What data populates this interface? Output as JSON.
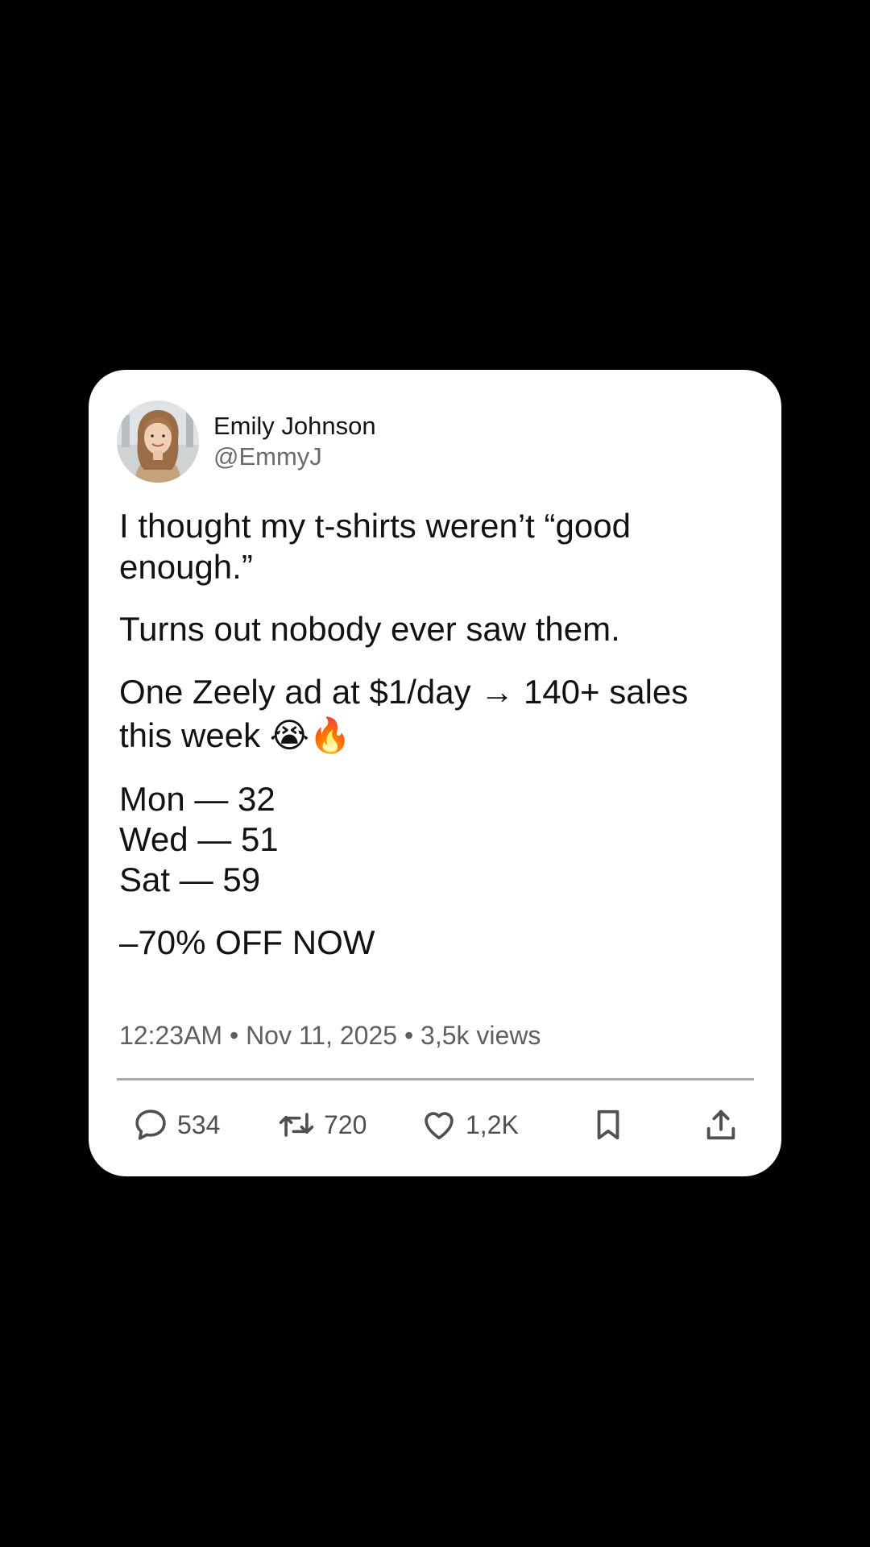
{
  "post": {
    "author": {
      "display_name": "Emily Johnson",
      "handle": "@EmmyJ"
    },
    "paragraphs": [
      "I thought my t-shirts weren’t “good enough.”",
      "Turns out nobody ever saw them.",
      "One Zeely ad at $1/day → 140+ sales this week 😭🔥"
    ],
    "stats": [
      "Mon — 32",
      "Wed — 51",
      "Sat — 59"
    ],
    "promo": "–70% OFF NOW",
    "meta": "12:23AM • Nov 11, 2025 • 3,5k views",
    "actions": {
      "reply_count": "534",
      "repost_count": "720",
      "like_count": "1,2K"
    },
    "icons": {
      "reply": "reply-bubble-icon",
      "repost": "repost-icon",
      "like": "heart-icon",
      "bookmark": "bookmark-icon",
      "share": "share-icon"
    },
    "colors": {
      "background": "#000000",
      "card": "#ffffff",
      "text": "#121212",
      "secondary_text": "#5f5f5f",
      "divider": "#a9a9a9"
    }
  }
}
